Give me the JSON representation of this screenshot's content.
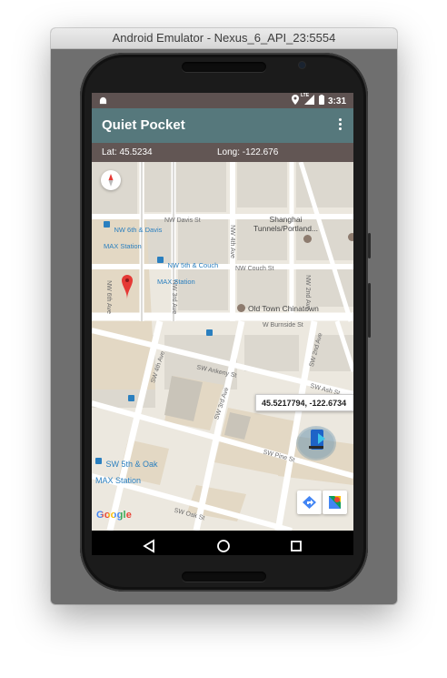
{
  "window": {
    "title": "Android Emulator - Nexus_6_API_23:5554"
  },
  "status_bar": {
    "time": "3:31",
    "network": "LTE"
  },
  "app_bar": {
    "title": "Quiet Pocket"
  },
  "coords": {
    "lat": "Lat: 45.5234",
    "long": "Long: -122.676"
  },
  "map": {
    "streets": {
      "nw_davis": "NW Davis St",
      "nw_couch": "NW Couch St",
      "w_burnside": "W Burnside St",
      "sw_ankeny": "SW Ankeny St",
      "sw_ash": "SW Ash St",
      "sw_pine": "SW Pine St",
      "sw_oak": "SW Oak St",
      "nw_4th": "NW 4th Ave",
      "nw_3rd": "NW 3rd Ave",
      "nw_2nd": "NW 2nd Ave",
      "sw_4th": "SW 4th Ave",
      "sw_3rd": "SW 3rd Ave",
      "sw_2nd": "SW 2nd Ave",
      "nw_6th": "NW 6th Ave"
    },
    "transit": {
      "stop1": "NW 6th & Davis\nMAX Station",
      "stop2": "NW 5th & Couch\nMAX Station",
      "stop3": "SW 5th & Oak\nMAX Station"
    },
    "pois": {
      "shanghai": "Shanghai\nTunnels/Portland...",
      "old_town": "Old Town Chinatown"
    },
    "marker_info": "45.5217794, -122.6734",
    "attribution": "Google"
  },
  "colors": {
    "app_bar": "#56787c",
    "status_bar": "#5e5251",
    "coord_bar": "#625654",
    "marker": "#e53935",
    "transit": "#2a7fbf"
  },
  "icons": {
    "status_android": "android-icon",
    "status_location": "location-icon",
    "status_signal": "signal-icon",
    "status_battery": "battery-icon",
    "overflow_menu": "overflow-menu-icon",
    "compass": "compass-icon",
    "directions": "directions-icon",
    "google_maps": "google-maps-icon",
    "back": "back-icon",
    "home": "home-icon",
    "recents": "recents-icon"
  }
}
